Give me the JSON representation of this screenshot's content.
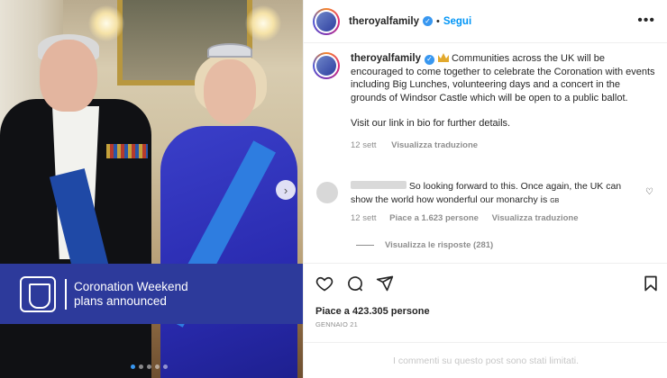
{
  "post": {
    "username": "theroyalfamily",
    "follow_label": "Segui",
    "separator": "•",
    "more_icon": "more-icon",
    "verified_icon": "verified-badge-icon",
    "image": {
      "banner_line1": "Coronation Weekend",
      "banner_line2": "plans announced",
      "carousel_next_icon": "chevron-right-icon",
      "carousel_next_glyph": "›",
      "slide_count": 5,
      "active_slide": 1
    },
    "caption": {
      "username": "theroyalfamily",
      "emoji_icon": "crown-icon",
      "text": "Communities across the UK will be encouraged to come together to celebrate the Coronation with events including Big Lunches, volunteering days and a concert in the grounds of Windsor Castle which will be open to a public ballot.",
      "text2": "Visit our link in bio for further details.",
      "time": "12 sett",
      "translate_label": "Visualizza traduzione"
    },
    "comment": {
      "text": "So looking forward to this. Once again, the UK can show the world how wonderful our monarchy is",
      "flag_text": "GB",
      "time": "12 sett",
      "likes_label": "Piace a 1.623 persone",
      "translate_label": "Visualizza traduzione",
      "replies_label": "Visualizza le risposte (281)"
    },
    "likes_label": "Piace a 423.305 persone",
    "date_label": "GENNAIO 21",
    "comments_limited_label": "I commenti su questo post sono stati limitati.",
    "accent": "#0095f6",
    "banner_color": "#2d3a9b"
  }
}
